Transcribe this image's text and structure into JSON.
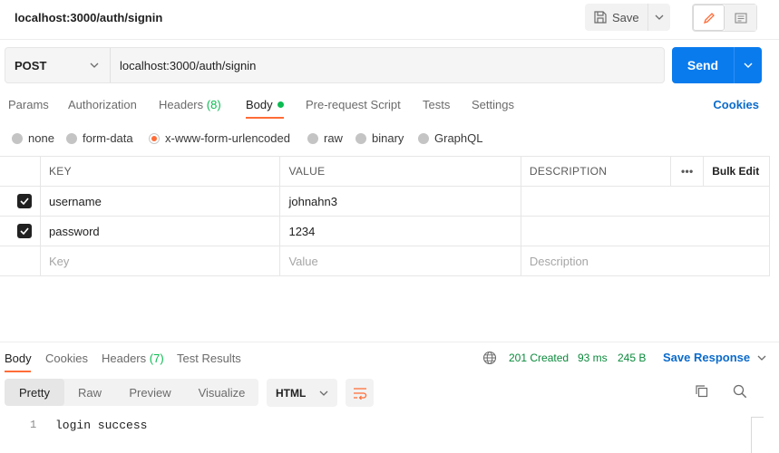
{
  "header": {
    "title": "localhost:3000/auth/signin",
    "save_label": "Save"
  },
  "request": {
    "method": "POST",
    "url": "localhost:3000/auth/signin",
    "send_label": "Send"
  },
  "request_tabs": {
    "params": "Params",
    "authorization": "Authorization",
    "headers": "Headers",
    "headers_count": "(8)",
    "body": "Body",
    "pre_request": "Pre-request Script",
    "tests": "Tests",
    "settings": "Settings",
    "cookies": "Cookies"
  },
  "body_types": {
    "none": "none",
    "form_data": "form-data",
    "urlencoded": "x-www-form-urlencoded",
    "raw": "raw",
    "binary": "binary",
    "graphql": "GraphQL",
    "selected": "x-www-form-urlencoded"
  },
  "params_table": {
    "col_key": "KEY",
    "col_value": "VALUE",
    "col_description": "DESCRIPTION",
    "more": "•••",
    "bulk_edit": "Bulk Edit",
    "rows": [
      {
        "checked": true,
        "key": "username",
        "value": "johnahn3",
        "description": ""
      },
      {
        "checked": true,
        "key": "password",
        "value": "1234",
        "description": ""
      }
    ],
    "placeholder_key": "Key",
    "placeholder_value": "Value",
    "placeholder_description": "Description"
  },
  "response": {
    "tabs": {
      "body": "Body",
      "cookies": "Cookies",
      "headers": "Headers",
      "headers_count": "(7)",
      "test_results": "Test Results"
    },
    "status": "201 Created",
    "time": "93 ms",
    "size": "245 B",
    "save_response": "Save Response",
    "views": {
      "pretty": "Pretty",
      "raw": "Raw",
      "preview": "Preview",
      "visualize": "Visualize"
    },
    "format": "HTML",
    "lines": [
      {
        "num": "1",
        "text": "login success"
      }
    ]
  },
  "colors": {
    "accent": "#ff6c37",
    "send": "#097bed",
    "link": "#0b6bcb",
    "success": "#0cbb52"
  }
}
